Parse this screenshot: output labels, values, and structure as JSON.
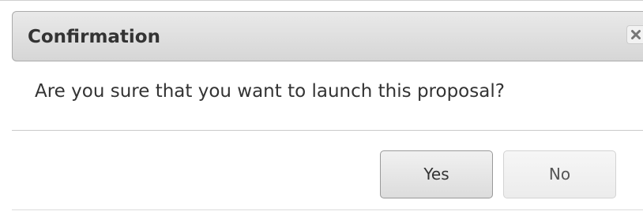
{
  "dialog": {
    "title": "Confirmation",
    "close_icon": "close-icon",
    "message": "Are you sure that you want to launch this proposal?",
    "buttons": {
      "yes_label": "Yes",
      "no_label": "No"
    }
  },
  "colors": {
    "titlebar_top": "#e9e9e9",
    "titlebar_bottom": "#d6d6d6",
    "text": "#333333",
    "border": "#aaaaaa"
  }
}
